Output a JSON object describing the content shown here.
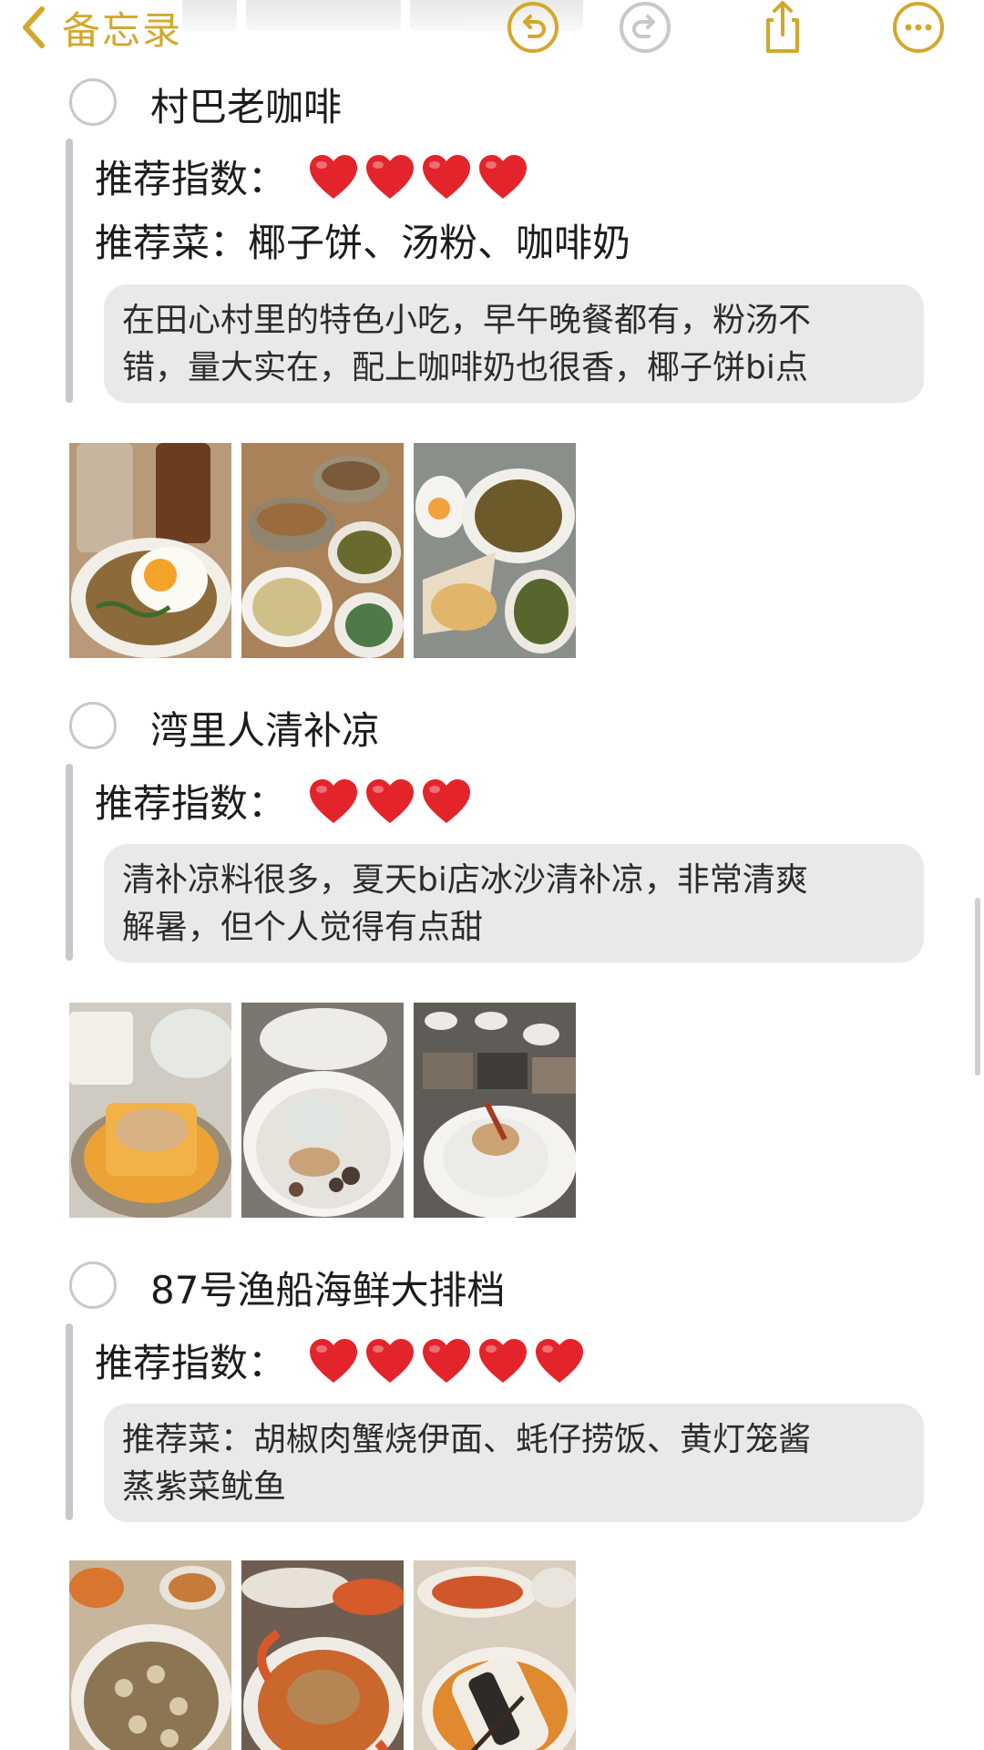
{
  "nav": {
    "back_label": "备忘录",
    "icons": [
      "chevron-left-icon",
      "undo-icon",
      "redo-icon",
      "share-icon",
      "more-icon"
    ],
    "accent_color": "#d4a72c"
  },
  "items": [
    {
      "title": "村巴老咖啡",
      "rating_label": "推荐指数：",
      "hearts": 4,
      "dishes": "推荐菜：椰子饼、汤粉、咖啡奶",
      "note_lines": [
        "在田心村里的特色小吃，早午晚餐都有，粉汤不",
        "错，量大实在，配上咖啡奶也很香，椰子饼bi点"
      ],
      "photos": [
        "iced-coffee-noodles-egg",
        "coffee-and-noodles-spread",
        "fried-noodles-coconut-cake"
      ]
    },
    {
      "title": "湾里人清补凉",
      "rating_label": "推荐指数：",
      "hearts": 3,
      "note_lines": [
        "清补凉料很多，夏天bi店冰沙清补凉，非常清爽",
        "解暑，但个人觉得有点甜"
      ],
      "photos": [
        "mango-tofu-peanut",
        "shaved-ice-dessert",
        "qingbuliang-bowls"
      ]
    },
    {
      "title": "87号渔船海鲜大排档",
      "rating_label": "推荐指数：",
      "hearts": 5,
      "note_lines": [
        "推荐菜：胡椒肉蟹烧伊面、蚝仔捞饭、黄灯笼酱",
        "蒸紫菜鱿鱼"
      ],
      "photos": [
        "oyster-rice",
        "crab-noodles",
        "squid-seaweed"
      ]
    }
  ],
  "colors": {
    "heart": "#e3242b",
    "callout_bg": "#e9e9eb",
    "quote_bar": "#c7c7cc"
  }
}
